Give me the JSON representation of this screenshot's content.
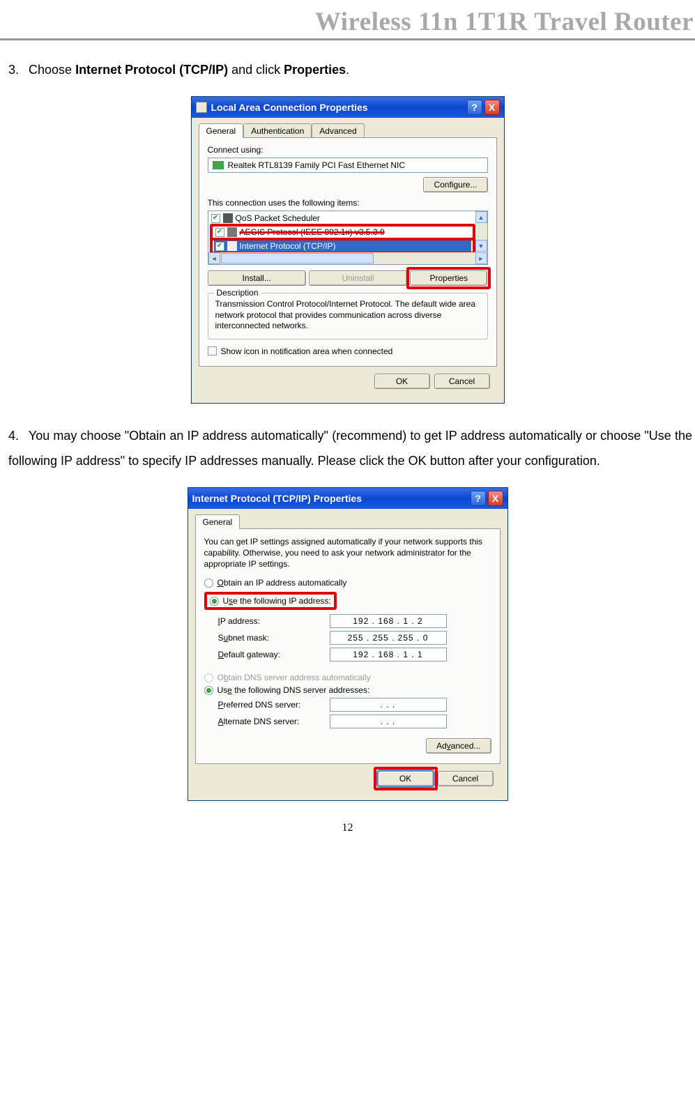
{
  "header": {
    "title": "Wireless 11n 1T1R Travel Router"
  },
  "step3": {
    "num": "3.",
    "pre": "Choose ",
    "bold1": "Internet Protocol (TCP/IP)",
    "mid": " and click ",
    "bold2": "Properties",
    "post": "."
  },
  "step4": {
    "num": "4.",
    "text": "You may choose \"Obtain an IP address automatically\" (recommend) to get IP address automatically or choose \"Use the following IP address\" to specify IP addresses manually. Please click the OK button after your configuration."
  },
  "page_number": "12",
  "dialog1": {
    "title": "Local Area Connection Properties",
    "help_btn": "?",
    "close_btn": "X",
    "tabs": [
      "General",
      "Authentication",
      "Advanced"
    ],
    "connect_using_label": "Connect using:",
    "adapter": "Realtek RTL8139 Family PCI Fast Ethernet NIC",
    "configure_btn": "Configure...",
    "items_label": "This connection uses the following items:",
    "items": [
      {
        "label": "QoS Packet Scheduler",
        "checked": true
      },
      {
        "label": "AEGIS Protocol (IEEE 802.1x) v3.5.3.0",
        "checked": true,
        "strike": true
      },
      {
        "label": "Internet Protocol (TCP/IP)",
        "checked": true,
        "selected": true
      }
    ],
    "install_btn": "Install...",
    "uninstall_btn": "Uninstall",
    "properties_btn": "Properties",
    "description_label": "Description",
    "description_text": "Transmission Control Protocol/Internet Protocol. The default wide area network protocol that provides communication across diverse interconnected networks.",
    "show_icon_label": "Show icon in notification area when connected",
    "ok_btn": "OK",
    "cancel_btn": "Cancel"
  },
  "dialog2": {
    "title": "Internet Protocol (TCP/IP) Properties",
    "help_btn": "?",
    "close_btn": "X",
    "tab": "General",
    "intro": "You can get IP settings assigned automatically if your network supports this capability. Otherwise, you need to ask your network administrator for the appropriate IP settings.",
    "radio_obtain_ip": "Obtain an IP address automatically",
    "radio_use_ip": "Use the following IP address:",
    "ip_address_label": "IP address:",
    "ip_address_value": "192 . 168 .  1  .  2",
    "subnet_label": "Subnet mask:",
    "subnet_value": "255 . 255 . 255 .  0",
    "gateway_label": "Default gateway:",
    "gateway_value": "192 . 168 .  1  .  1",
    "radio_obtain_dns": "Obtain DNS server address automatically",
    "radio_use_dns": "Use the following DNS server addresses:",
    "pref_dns_label": "Preferred DNS server:",
    "pref_dns_value": " .       .       . ",
    "alt_dns_label": "Alternate DNS server:",
    "alt_dns_value": " .       .       . ",
    "advanced_btn": "Advanced...",
    "ok_btn": "OK",
    "cancel_btn": "Cancel"
  }
}
